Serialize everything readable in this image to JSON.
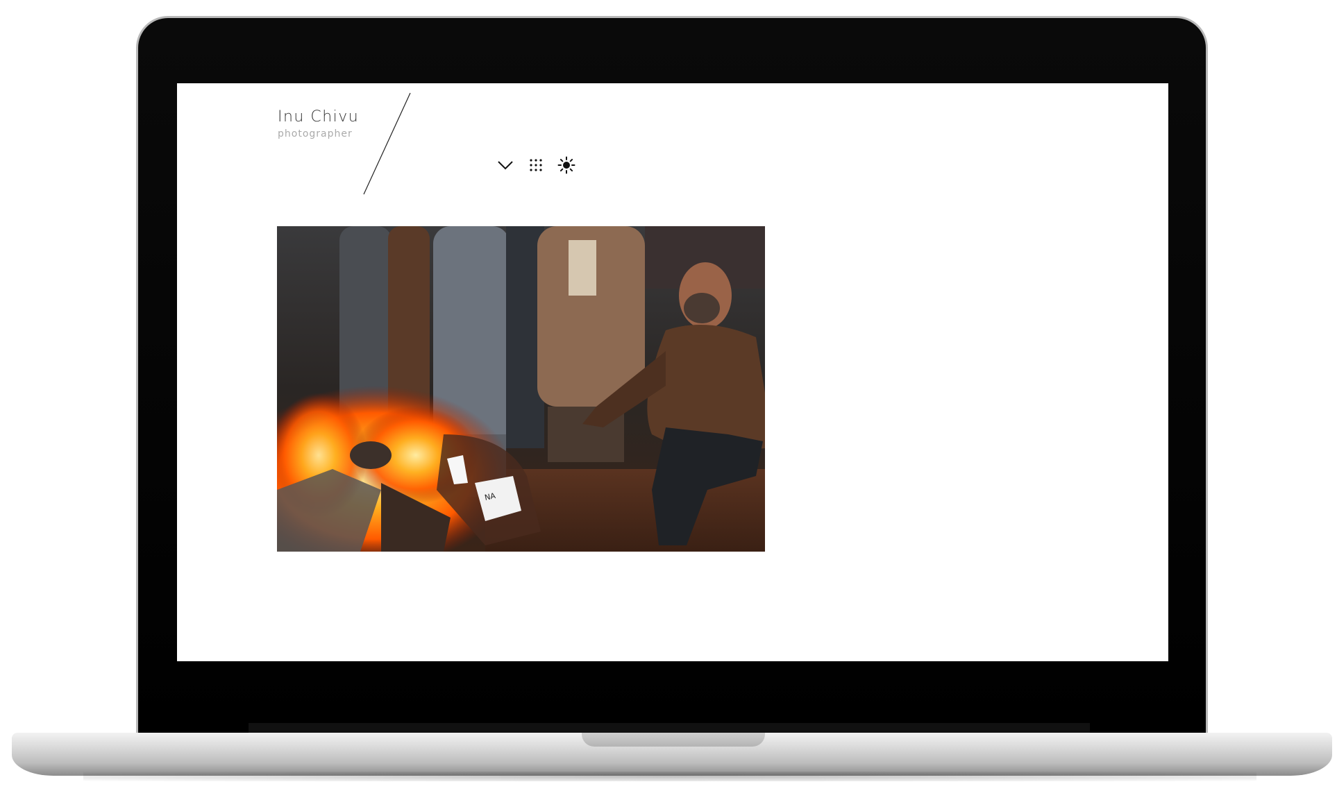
{
  "site": {
    "title": "Inu Chivu",
    "tagline": "photographer"
  },
  "icons": {
    "menu": "chevron-down-icon",
    "gallery": "grid-dots-icon",
    "theme": "sun-icon"
  },
  "photo": {
    "subject": "fire-and-crowd-photo"
  },
  "colors": {
    "screen_background": "#ffffff",
    "title_text": "#333333",
    "tagline_text": "#aaaaaa"
  }
}
